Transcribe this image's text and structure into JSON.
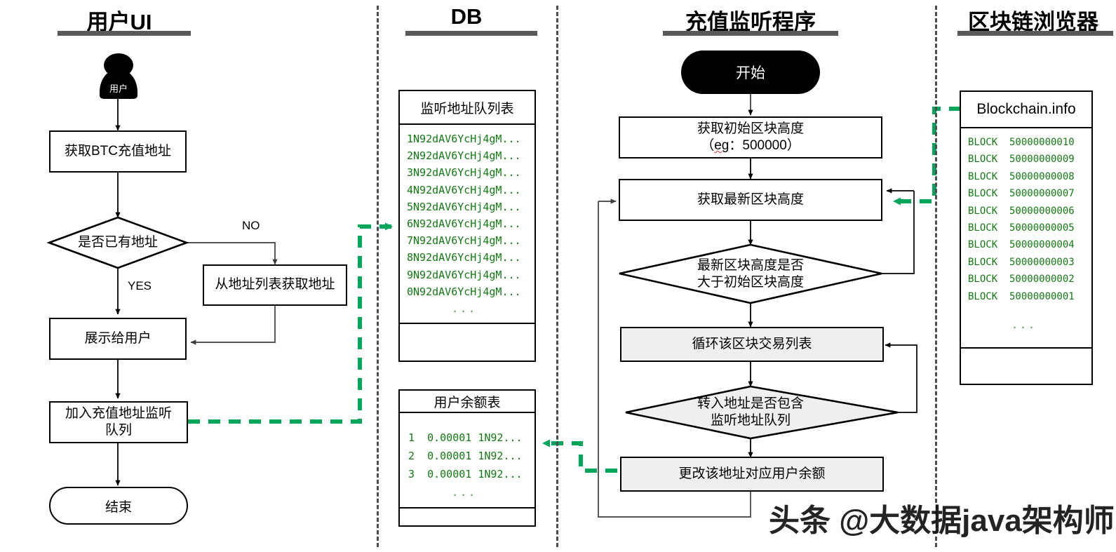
{
  "colors": {
    "green_flow": "#00A65A",
    "green_text": "#137a13",
    "lane_rule": "#595959",
    "loop_fill": "#efefef",
    "loop_border": "#9a9a9a"
  },
  "lanes": [
    {
      "id": "user-ui",
      "title": "用户UI"
    },
    {
      "id": "db",
      "title": "DB"
    },
    {
      "id": "listener",
      "title": "充值监听程序"
    },
    {
      "id": "explorer",
      "title": "区块链浏览器"
    }
  ],
  "user_ui": {
    "actor_label": "用户",
    "nodes": {
      "get_addr": "获取BTC充值地址",
      "has_addr": "是否已有地址",
      "fetch_from_list": "从地址列表获取地址",
      "show_user": "展示给用户",
      "enqueue_line1": "加入充值地址监听",
      "enqueue_line2": "队列",
      "end": "结束"
    },
    "edge_labels": {
      "no": "NO",
      "yes": "YES"
    }
  },
  "db": {
    "watch_table": {
      "title": "监听地址队列表",
      "rows": [
        "1N92dAV6YcHj4gM...",
        "2N92dAV6YcHj4gM...",
        "3N92dAV6YcHj4gM...",
        "4N92dAV6YcHj4gM...",
        "5N92dAV6YcHj4gM...",
        "6N92dAV6YcHj4gM...",
        "7N92dAV6YcHj4gM...",
        "8N92dAV6YcHj4gM...",
        "9N92dAV6YcHj4gM...",
        "0N92dAV6YcHj4gM..."
      ],
      "more": "..."
    },
    "balance_table": {
      "title": "用户余额表",
      "rows": [
        "1  0.00001 1N92...",
        "2  0.00001 1N92...",
        "3  0.00001 1N92..."
      ],
      "more": "..."
    }
  },
  "listener": {
    "nodes": {
      "start": "开始",
      "init_height_line1": "获取初始区块高度",
      "init_height_line2_pre": "（",
      "init_height_line2_spell": "eg",
      "init_height_line2_post": "：500000）",
      "latest_height": "获取最新区块高度",
      "compare_line1": "最新区块高度是否",
      "compare_line2": "大于初始区块高度",
      "loop_txs": "循环该区块交易列表",
      "contains_line1": "转入地址是否包含",
      "contains_line2": "监听地址队列",
      "update_balance": "更改该地址对应用户余额"
    }
  },
  "explorer": {
    "card": {
      "title": "Blockchain.info",
      "rows": [
        "BLOCK  50000000010",
        "BLOCK  50000000009",
        "BLOCK  50000000008",
        "BLOCK  50000000007",
        "BLOCK  50000000006",
        "BLOCK  50000000005",
        "BLOCK  50000000004",
        "BLOCK  50000000003",
        "BLOCK  50000000002",
        "BLOCK  50000000001"
      ],
      "more": "..."
    }
  },
  "watermark": {
    "text": "头条 @大数据java架构师"
  }
}
